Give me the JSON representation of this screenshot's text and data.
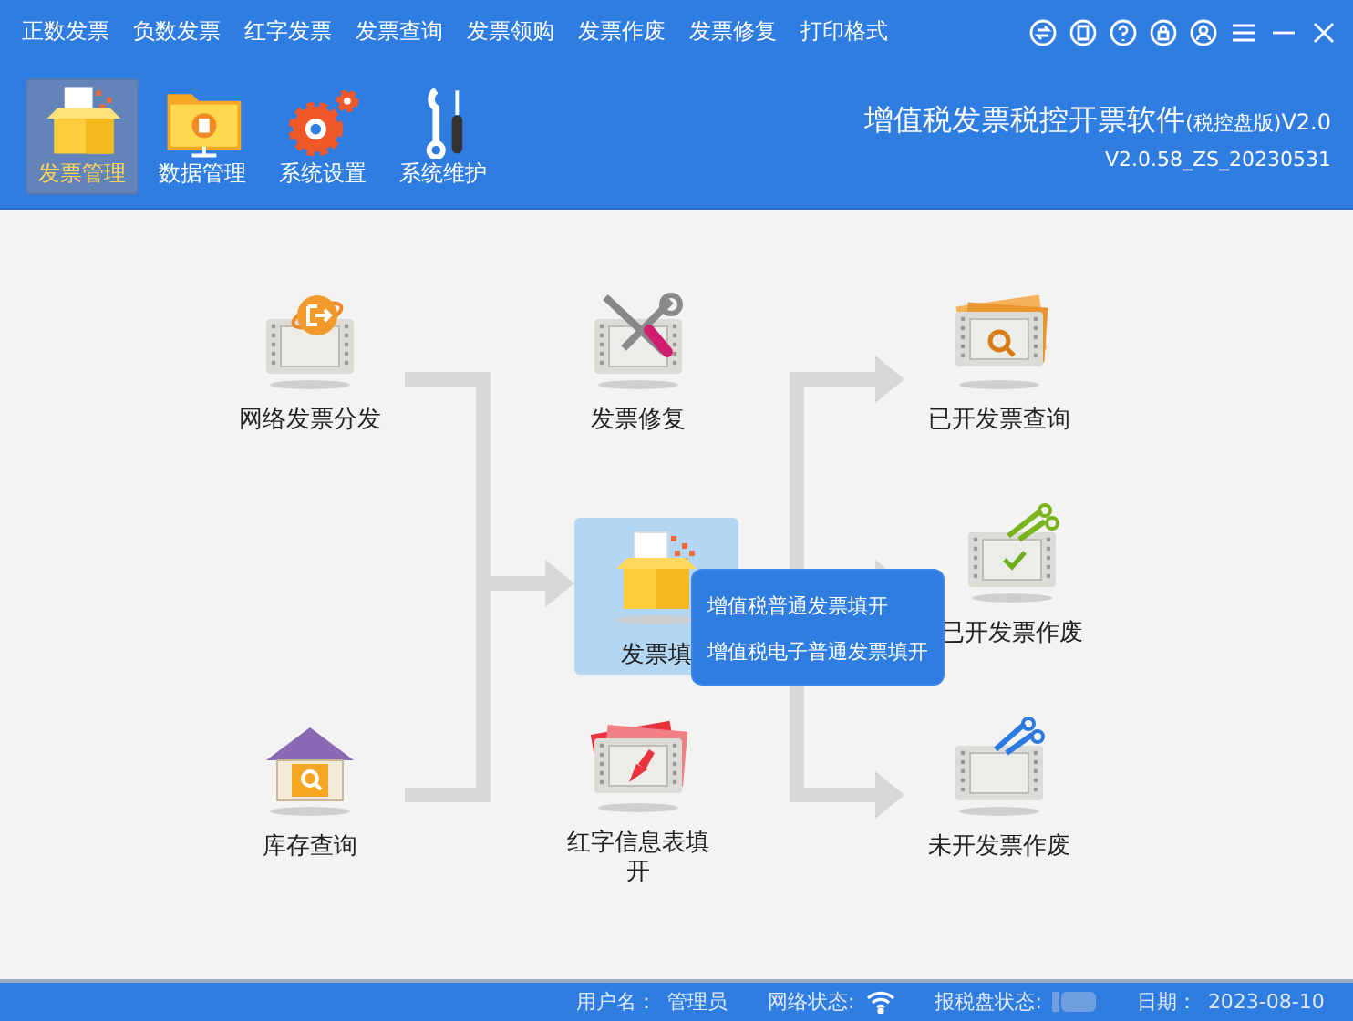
{
  "menu": [
    {
      "label": "正数发票"
    },
    {
      "label": "负数发票"
    },
    {
      "label": "红字发票"
    },
    {
      "label": "发票查询"
    },
    {
      "label": "发票领购"
    },
    {
      "label": "发票作废"
    },
    {
      "label": "发票修复"
    },
    {
      "label": "打印格式"
    }
  ],
  "toolbar": [
    {
      "label": "发票管理",
      "kind": "box",
      "selected": true
    },
    {
      "label": "数据管理",
      "kind": "folder",
      "selected": false
    },
    {
      "label": "系统设置",
      "kind": "gears",
      "selected": false
    },
    {
      "label": "系统维护",
      "kind": "tools",
      "selected": false
    }
  ],
  "app_title": {
    "name": "增值税发票税控开票软件",
    "edition": "(税控盘版)",
    "version": "V2.0",
    "build": "V2.0.58_ZS_20230531"
  },
  "flow_nodes": [
    {
      "label": "网络发票分发",
      "kind": "distribute",
      "selected": false
    },
    {
      "label": "发票修复",
      "kind": "repair",
      "selected": false
    },
    {
      "label": "已开发票查询",
      "kind": "query",
      "selected": false
    },
    {
      "label": "发票填",
      "kind": "fill",
      "selected": true
    },
    {
      "label": "已开发票作废",
      "kind": "void_issued",
      "selected": false
    },
    {
      "label": "库存查询",
      "kind": "stock",
      "selected": false
    },
    {
      "label": "红字信息表填开",
      "kind": "red_letter",
      "selected": false
    },
    {
      "label": "未开发票作废",
      "kind": "void_blank",
      "selected": false
    }
  ],
  "popup_menu": [
    {
      "label": "增值税普通发票填开"
    },
    {
      "label": "增值税电子普通发票填开"
    }
  ],
  "status_bar": {
    "user_label": "用户名：",
    "user": "管理员",
    "network_label": "网络状态:",
    "network_connected": true,
    "disk_label": "报税盘状态:",
    "disk_connected": false,
    "date_label": "日期：",
    "date": "2023-08-10"
  }
}
